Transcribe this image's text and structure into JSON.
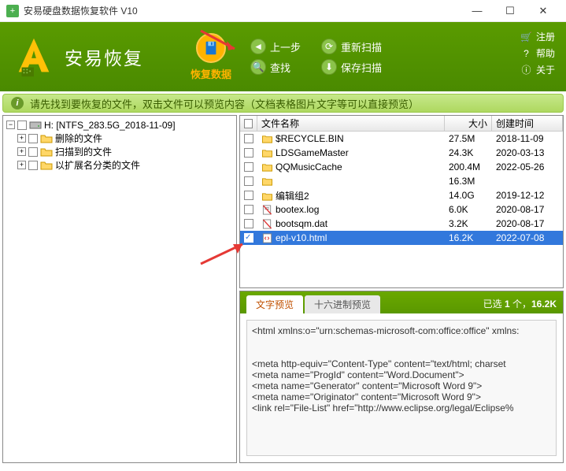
{
  "app": {
    "title": "安易硬盘数据恢复软件 V10",
    "logo_text": "安易恢复"
  },
  "main_action": {
    "label": "恢复数据"
  },
  "nav": {
    "prev": "上一步",
    "rescan": "重新扫描",
    "search": "查找",
    "savescan": "保存扫描"
  },
  "rightlinks": {
    "register": "注册",
    "help": "帮助",
    "about": "关于"
  },
  "infobar": {
    "text": "请先找到要恢复的文件，双击文件可以预览内容（文档表格图片文字等可以直接预览）"
  },
  "tree": {
    "root": "H: [NTFS_283.5G_2018-11-09]",
    "children": [
      "删除的文件",
      "扫描到的文件",
      "以扩展名分类的文件"
    ]
  },
  "filelist": {
    "headers": {
      "name": "文件名称",
      "size": "大小",
      "date": "创建时间"
    },
    "rows": [
      {
        "name": "$RECYCLE.BIN",
        "size": "27.5M",
        "date": "2018-11-09",
        "icon": "folder",
        "checked": false
      },
      {
        "name": "LDSGameMaster",
        "size": "24.3K",
        "date": "2020-03-13",
        "icon": "folder",
        "checked": false
      },
      {
        "name": "QQMusicCache",
        "size": "200.4M",
        "date": "2022-05-26",
        "icon": "folder",
        "checked": false
      },
      {
        "name": "",
        "size": "16.3M",
        "date": "",
        "icon": "folder",
        "checked": false
      },
      {
        "name": "编辑组2",
        "size": "14.0G",
        "date": "2019-12-12",
        "icon": "folder",
        "checked": false
      },
      {
        "name": "bootex.log",
        "size": "6.0K",
        "date": "2020-08-17",
        "icon": "logfile",
        "checked": false
      },
      {
        "name": "bootsqm.dat",
        "size": "3.2K",
        "date": "2020-08-17",
        "icon": "datfile",
        "checked": false
      },
      {
        "name": "epl-v10.html",
        "size": "16.2K",
        "date": "2022-07-08",
        "icon": "htmlfile",
        "checked": true,
        "selected": true
      }
    ]
  },
  "preview": {
    "tab_text": "文字预览",
    "tab_hex": "十六进制预览",
    "status_prefix": "已选 ",
    "status_count": "1",
    "status_mid": " 个，",
    "status_size": "16.2K",
    "content": "<html xmlns:o=\"urn:schemas-microsoft-com:office:office\" xmlns:\n\n\n<meta http-equiv=\"Content-Type\" content=\"text/html; charset\n<meta name=\"ProgId\" content=\"Word.Document\">\n<meta name=\"Generator\" content=\"Microsoft Word 9\">\n<meta name=\"Originator\" content=\"Microsoft Word 9\">\n<link rel=\"File-List\" href=\"http://www.eclipse.org/legal/Eclipse%"
  }
}
